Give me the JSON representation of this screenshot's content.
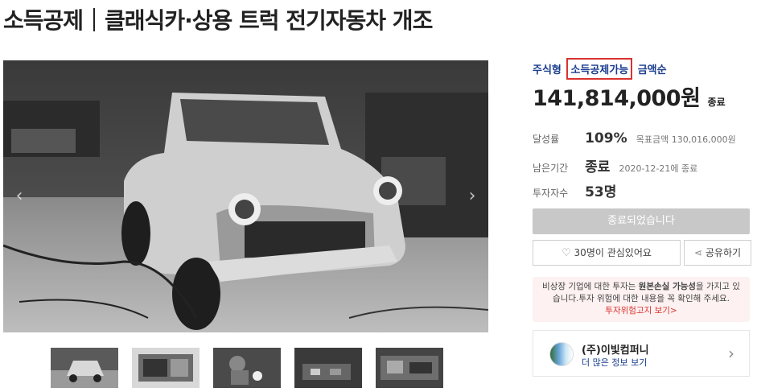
{
  "header": {
    "title": "소득공제｜클래식카·상용 트럭 전기자동차 개조"
  },
  "gallery": {
    "prev_arrow": "‹",
    "next_arrow": "›",
    "thumbnail_count": 5
  },
  "tags": {
    "tag1": "주식형",
    "tag2": "소득공제가능",
    "tag3": "금액순"
  },
  "amount": {
    "value": "141,814,000원",
    "status": "종료"
  },
  "stats": {
    "rate_label": "달성률",
    "rate_value": "109%",
    "rate_sub": "목표금액 130,016,000원",
    "remain_label": "남은기간",
    "remain_value": "종료",
    "remain_sub": "2020-12-21에 종료",
    "investors_label": "투자자수",
    "investors_value": "53명"
  },
  "buttons": {
    "closed_label": "종료되었습니다",
    "like_label": "30명이 관심있어요",
    "share_label": "공유하기"
  },
  "warning": {
    "line1_pre": "비상장 기업에 대한 투자는 ",
    "line1_bold": "원본손실 가능성",
    "line1_post": "을 가지고 있",
    "line2": "습니다.투자 위험에 대한 내용을 꼭 확인해 주세요.",
    "link": "투자위험고지 보기>"
  },
  "company": {
    "name": "(주)이빛컴퍼니",
    "more": "더 많은 정보 보기"
  },
  "colors": {
    "accent_blue": "#1a3d8f",
    "highlight_red": "#d9322f"
  }
}
